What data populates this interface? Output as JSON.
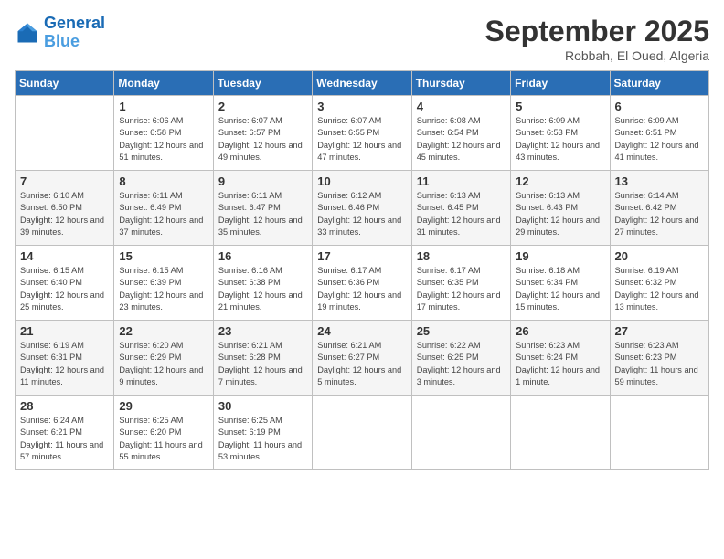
{
  "header": {
    "logo_line1": "General",
    "logo_line2": "Blue",
    "month": "September 2025",
    "location": "Robbah, El Oued, Algeria"
  },
  "days_of_week": [
    "Sunday",
    "Monday",
    "Tuesday",
    "Wednesday",
    "Thursday",
    "Friday",
    "Saturday"
  ],
  "weeks": [
    [
      {
        "num": "",
        "sunrise": "",
        "sunset": "",
        "daylight": ""
      },
      {
        "num": "1",
        "sunrise": "6:06 AM",
        "sunset": "6:58 PM",
        "daylight": "12 hours and 51 minutes."
      },
      {
        "num": "2",
        "sunrise": "6:07 AM",
        "sunset": "6:57 PM",
        "daylight": "12 hours and 49 minutes."
      },
      {
        "num": "3",
        "sunrise": "6:07 AM",
        "sunset": "6:55 PM",
        "daylight": "12 hours and 47 minutes."
      },
      {
        "num": "4",
        "sunrise": "6:08 AM",
        "sunset": "6:54 PM",
        "daylight": "12 hours and 45 minutes."
      },
      {
        "num": "5",
        "sunrise": "6:09 AM",
        "sunset": "6:53 PM",
        "daylight": "12 hours and 43 minutes."
      },
      {
        "num": "6",
        "sunrise": "6:09 AM",
        "sunset": "6:51 PM",
        "daylight": "12 hours and 41 minutes."
      }
    ],
    [
      {
        "num": "7",
        "sunrise": "6:10 AM",
        "sunset": "6:50 PM",
        "daylight": "12 hours and 39 minutes."
      },
      {
        "num": "8",
        "sunrise": "6:11 AM",
        "sunset": "6:49 PM",
        "daylight": "12 hours and 37 minutes."
      },
      {
        "num": "9",
        "sunrise": "6:11 AM",
        "sunset": "6:47 PM",
        "daylight": "12 hours and 35 minutes."
      },
      {
        "num": "10",
        "sunrise": "6:12 AM",
        "sunset": "6:46 PM",
        "daylight": "12 hours and 33 minutes."
      },
      {
        "num": "11",
        "sunrise": "6:13 AM",
        "sunset": "6:45 PM",
        "daylight": "12 hours and 31 minutes."
      },
      {
        "num": "12",
        "sunrise": "6:13 AM",
        "sunset": "6:43 PM",
        "daylight": "12 hours and 29 minutes."
      },
      {
        "num": "13",
        "sunrise": "6:14 AM",
        "sunset": "6:42 PM",
        "daylight": "12 hours and 27 minutes."
      }
    ],
    [
      {
        "num": "14",
        "sunrise": "6:15 AM",
        "sunset": "6:40 PM",
        "daylight": "12 hours and 25 minutes."
      },
      {
        "num": "15",
        "sunrise": "6:15 AM",
        "sunset": "6:39 PM",
        "daylight": "12 hours and 23 minutes."
      },
      {
        "num": "16",
        "sunrise": "6:16 AM",
        "sunset": "6:38 PM",
        "daylight": "12 hours and 21 minutes."
      },
      {
        "num": "17",
        "sunrise": "6:17 AM",
        "sunset": "6:36 PM",
        "daylight": "12 hours and 19 minutes."
      },
      {
        "num": "18",
        "sunrise": "6:17 AM",
        "sunset": "6:35 PM",
        "daylight": "12 hours and 17 minutes."
      },
      {
        "num": "19",
        "sunrise": "6:18 AM",
        "sunset": "6:34 PM",
        "daylight": "12 hours and 15 minutes."
      },
      {
        "num": "20",
        "sunrise": "6:19 AM",
        "sunset": "6:32 PM",
        "daylight": "12 hours and 13 minutes."
      }
    ],
    [
      {
        "num": "21",
        "sunrise": "6:19 AM",
        "sunset": "6:31 PM",
        "daylight": "12 hours and 11 minutes."
      },
      {
        "num": "22",
        "sunrise": "6:20 AM",
        "sunset": "6:29 PM",
        "daylight": "12 hours and 9 minutes."
      },
      {
        "num": "23",
        "sunrise": "6:21 AM",
        "sunset": "6:28 PM",
        "daylight": "12 hours and 7 minutes."
      },
      {
        "num": "24",
        "sunrise": "6:21 AM",
        "sunset": "6:27 PM",
        "daylight": "12 hours and 5 minutes."
      },
      {
        "num": "25",
        "sunrise": "6:22 AM",
        "sunset": "6:25 PM",
        "daylight": "12 hours and 3 minutes."
      },
      {
        "num": "26",
        "sunrise": "6:23 AM",
        "sunset": "6:24 PM",
        "daylight": "12 hours and 1 minute."
      },
      {
        "num": "27",
        "sunrise": "6:23 AM",
        "sunset": "6:23 PM",
        "daylight": "11 hours and 59 minutes."
      }
    ],
    [
      {
        "num": "28",
        "sunrise": "6:24 AM",
        "sunset": "6:21 PM",
        "daylight": "11 hours and 57 minutes."
      },
      {
        "num": "29",
        "sunrise": "6:25 AM",
        "sunset": "6:20 PM",
        "daylight": "11 hours and 55 minutes."
      },
      {
        "num": "30",
        "sunrise": "6:25 AM",
        "sunset": "6:19 PM",
        "daylight": "11 hours and 53 minutes."
      },
      {
        "num": "",
        "sunrise": "",
        "sunset": "",
        "daylight": ""
      },
      {
        "num": "",
        "sunrise": "",
        "sunset": "",
        "daylight": ""
      },
      {
        "num": "",
        "sunrise": "",
        "sunset": "",
        "daylight": ""
      },
      {
        "num": "",
        "sunrise": "",
        "sunset": "",
        "daylight": ""
      }
    ]
  ]
}
